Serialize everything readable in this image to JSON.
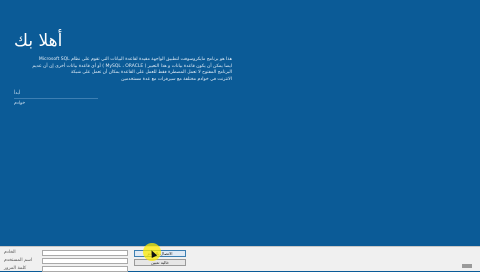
{
  "welcome": {
    "title": "أهلا بك"
  },
  "intro": {
    "lines": [
      "هذا هو برنامج مايكروسوفت لتطبيق الواجهة مقيدة لقاعدة البيانات التي تقوم على نظام Microsoft SQL",
      "ايضا يمكن أن يكون قاعدة بيانات و هذا التعبير ( MySQL ، ORACLE ) أو أي قاعدة بيانات أخرى إن أن عديم",
      "البرنامج المفتوح لا تعمل المضطرة فقط للعمل على القاعدة بمكان أن تعمل على شبكة",
      "الانترنت في خوادم مختلفة مع سيرفرات مع عدة مستخدمين"
    ]
  },
  "field": {
    "label": "أبدأ",
    "value": "خوادم"
  },
  "form": {
    "server_label": "الخادم",
    "username_label": "اسم المستخدم",
    "password_label": "كلمة المرور",
    "server_value": "",
    "username_value": "",
    "password_value": ""
  },
  "buttons": {
    "connect_label": "الاتصال بالخادم",
    "cancel_label": "خالية تعيين"
  }
}
